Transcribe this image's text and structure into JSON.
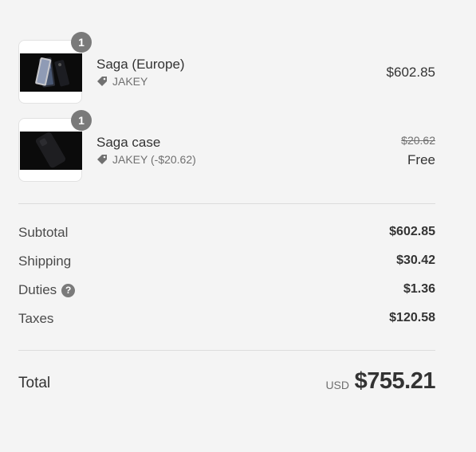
{
  "items": [
    {
      "name": "Saga (Europe)",
      "quantity": "1",
      "discount_label": "JAKEY",
      "price": "$602.85",
      "thumbnail_icon": "phone-image"
    },
    {
      "name": "Saga case",
      "quantity": "1",
      "discount_label": "JAKEY (-$20.62)",
      "original_price": "$20.62",
      "price": "Free",
      "thumbnail_icon": "phone-case-image"
    }
  ],
  "summary": {
    "subtotal_label": "Subtotal",
    "subtotal_value": "$602.85",
    "shipping_label": "Shipping",
    "shipping_value": "$30.42",
    "duties_label": "Duties",
    "duties_value": "$1.36",
    "taxes_label": "Taxes",
    "taxes_value": "$120.58"
  },
  "total": {
    "label": "Total",
    "currency": "USD",
    "amount": "$755.21"
  },
  "colors": {
    "background": "#f4f4f4",
    "badge": "#7a7a7a",
    "text": "#333333",
    "muted": "#707070"
  }
}
